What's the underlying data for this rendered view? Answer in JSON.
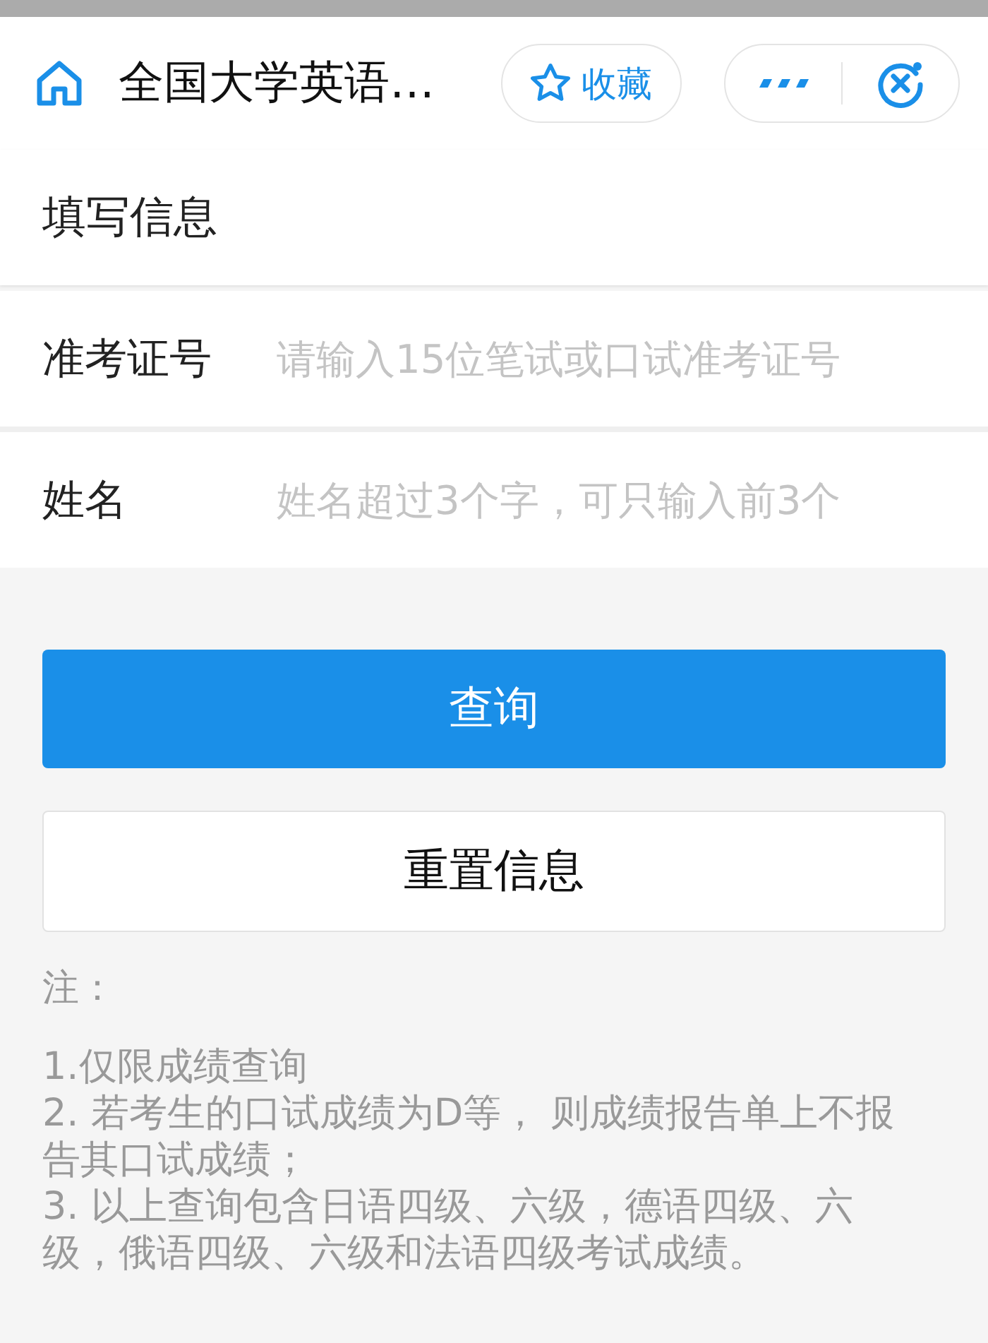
{
  "header": {
    "title": "全国大学英语…",
    "favorite_label": "收藏"
  },
  "section_title": "填写信息",
  "fields": [
    {
      "label": "准考证号",
      "placeholder": "请输入15位笔试或口试准考证号"
    },
    {
      "label": "姓名",
      "placeholder": "姓名超过3个字，可只输入前3个"
    }
  ],
  "buttons": [
    {
      "label": "查询",
      "kind": "primary"
    },
    {
      "label": "重置信息",
      "kind": "secondary"
    }
  ],
  "notes": {
    "heading": "注：",
    "items": [
      "1.仅限成绩查询",
      "2. 若考生的口试成绩为D等， 则成绩报告单上不报告其口试成绩；",
      "3. 以上查询包含日语四级、六级，德语四级、六级，俄语四级、六级和法语四级考试成绩。"
    ]
  }
}
